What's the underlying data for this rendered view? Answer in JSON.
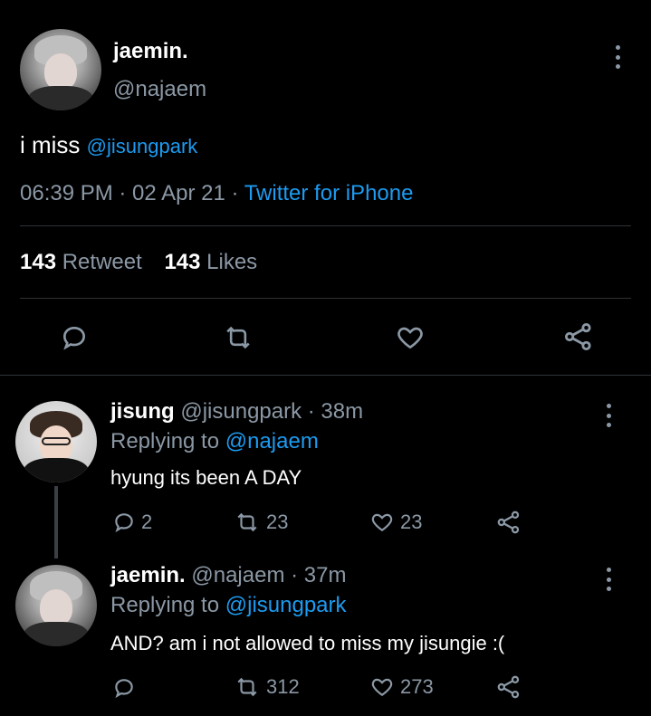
{
  "main_tweet": {
    "display_name": "jaemin.",
    "handle": "@najaem",
    "text_prefix": "i miss",
    "mention": "@jisungpark",
    "time": "06:39 PM · 02 Apr 21 ·",
    "source": "Twitter for iPhone",
    "retweets_count": "143",
    "retweets_label": "Retweet",
    "likes_count": "143",
    "likes_label": "Likes"
  },
  "replies": [
    {
      "display_name": "jisung",
      "handle_time": "@jisungpark · 38m",
      "replying_to_label": "Replying to",
      "replying_to_handle": "@najaem",
      "text": "hyung its been A DAY",
      "reply_count": "2",
      "retweet_count": "23",
      "like_count": "23"
    },
    {
      "display_name": "jaemin.",
      "handle_time": "@najaem · 37m",
      "replying_to_label": "Replying to",
      "replying_to_handle": "@jisungpark",
      "text": "AND? am i not allowed to miss my jisungie :(",
      "reply_count": "",
      "retweet_count": "312",
      "like_count": "273"
    }
  ],
  "icons": [
    "more-icon",
    "reply-icon",
    "retweet-icon",
    "like-icon",
    "share-icon"
  ],
  "colors": {
    "background": "#000000",
    "link": "#1d9bf0",
    "muted": "#8b98a5",
    "text": "#e7e9ea"
  }
}
